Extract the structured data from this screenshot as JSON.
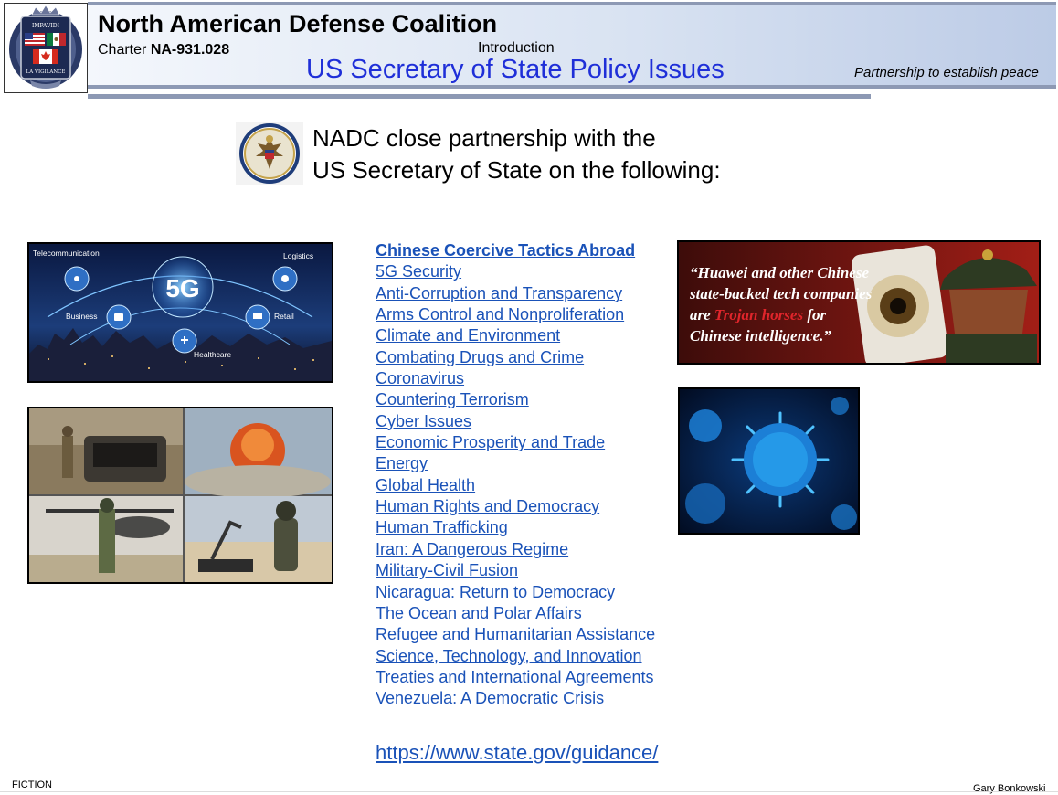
{
  "header": {
    "org_name": "North American Defense Coalition",
    "charter_label": "Charter",
    "charter_number": "NA-931.028",
    "section": "Introduction",
    "title": "US Secretary of State Policy Issues",
    "tagline": "Partnership to establish peace"
  },
  "logo": {
    "motto_top": "IMPAVIDI",
    "motto_bottom": "LA VIGILANCE"
  },
  "intro": {
    "line1": "NADC close partnership with the",
    "line2": "US Secretary of State on the following:"
  },
  "images": {
    "fiveg": {
      "center": "5G",
      "labels": [
        "Telecommunication",
        "Logistics",
        "Business",
        "Retail",
        "Healthcare"
      ]
    },
    "huawei_quote": {
      "line1": "“Huawei and other Chinese",
      "line2": "state-backed tech companies",
      "line3_pre": "are ",
      "line3_red": "Trojan horses",
      "line3_post": " for",
      "line4": "Chinese intelligence.”"
    }
  },
  "topics": [
    "Chinese Coercive Tactics Abroad",
    "5G Security",
    "Anti-Corruption and Transparency",
    "Arms Control and Nonproliferation",
    "Climate and Environment",
    "Combating Drugs and Crime",
    "Coronavirus",
    "Countering Terrorism",
    "Cyber Issues",
    "Economic Prosperity and Trade",
    "Energy",
    "Global Health",
    "Human Rights and Democracy",
    "Human Trafficking",
    "Iran: A Dangerous Regime",
    "Military-Civil Fusion",
    "Nicaragua: Return to Democracy",
    "The Ocean and Polar Affairs",
    "Refugee and Humanitarian Assistance",
    "Science, Technology, and Innovation",
    "Treaties and International Agreements",
    "Venezuela: A Democratic Crisis"
  ],
  "link": {
    "url_text": "https://www.state.gov/guidance/"
  },
  "footer": {
    "left": "FICTION",
    "right": "Gary Bonkowski"
  },
  "colors": {
    "title_blue": "#1f2fd8",
    "link_blue": "#1a52b8",
    "rule_gray": "#8d99b4",
    "quote_red": "#e0252b"
  }
}
